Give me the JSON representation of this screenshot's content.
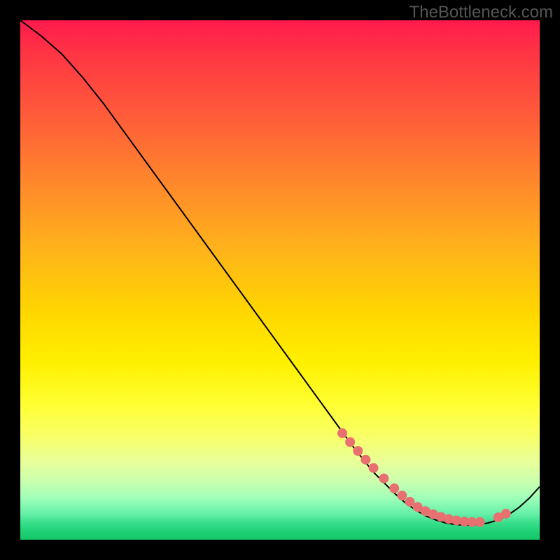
{
  "watermark": "TheBottleneck.com",
  "chart_data": {
    "type": "line",
    "title": "",
    "xlabel": "",
    "ylabel": "",
    "xlim": [
      0,
      100
    ],
    "ylim": [
      0,
      100
    ],
    "series": [
      {
        "name": "curve",
        "x": [
          0,
          4,
          8,
          12,
          16,
          20,
          24,
          28,
          32,
          36,
          40,
          44,
          48,
          52,
          56,
          60,
          64,
          68,
          72,
          74,
          76,
          78,
          80,
          82,
          84,
          86,
          88,
          90,
          92,
          94,
          96,
          98,
          100
        ],
        "y": [
          100,
          97,
          93.5,
          89,
          84,
          78.5,
          73,
          67.5,
          62,
          56.5,
          51,
          45.5,
          40,
          34.5,
          29,
          23.5,
          18,
          13,
          9,
          7.2,
          5.8,
          4.6,
          3.8,
          3.2,
          2.9,
          2.8,
          2.9,
          3.2,
          3.8,
          4.8,
          6.2,
          8.0,
          10.2
        ]
      }
    ],
    "points": {
      "name": "markers",
      "x": [
        62,
        63.5,
        65,
        66.5,
        68,
        70,
        72,
        73.5,
        75,
        76.5,
        78,
        79.5,
        81,
        82.5,
        84,
        85.5,
        87,
        88.5,
        92,
        93.5
      ],
      "y": [
        20.5,
        18.8,
        17.1,
        15.4,
        13.8,
        11.8,
        9.9,
        8.5,
        7.3,
        6.3,
        5.5,
        4.9,
        4.4,
        4.0,
        3.7,
        3.5,
        3.4,
        3.4,
        4.3,
        5.0
      ]
    }
  }
}
